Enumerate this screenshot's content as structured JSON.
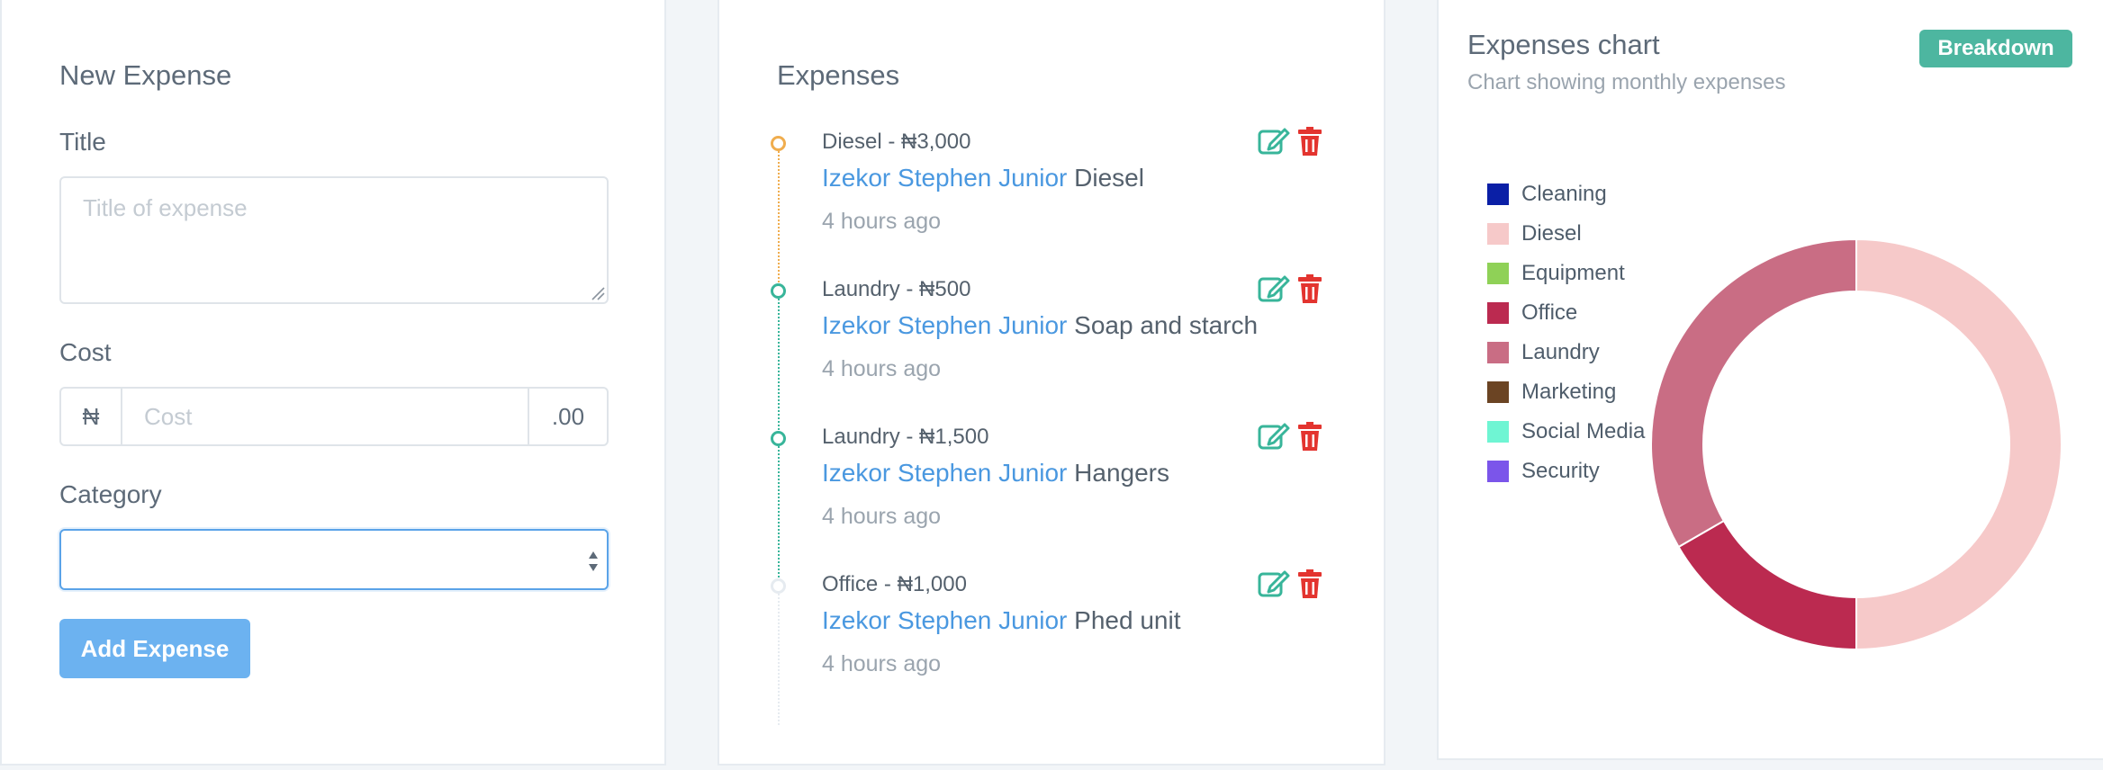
{
  "new_expense": {
    "title": "New Expense",
    "title_label": "Title",
    "title_placeholder": "Title of expense",
    "cost_label": "Cost",
    "currency_prefix": "₦",
    "cost_placeholder": "Cost",
    "cost_suffix": ".00",
    "category_label": "Category",
    "category_value": "",
    "add_button": "Add Expense"
  },
  "expenses": {
    "title": "Expenses",
    "items": [
      {
        "header": "Diesel - ₦3,000",
        "user": "Izekor Stephen Junior",
        "description": "Diesel",
        "time": "4 hours ago",
        "dot_color": "#f0ad4e",
        "line_color": "#f0ad4e"
      },
      {
        "header": "Laundry - ₦500",
        "user": "Izekor Stephen Junior",
        "description": "Soap and starch",
        "time": "4 hours ago",
        "dot_color": "#38b59a",
        "line_color": "#38b59a"
      },
      {
        "header": "Laundry - ₦1,500",
        "user": "Izekor Stephen Junior",
        "description": "Hangers",
        "time": "4 hours ago",
        "dot_color": "#38b59a",
        "line_color": "#38b59a"
      },
      {
        "header": "Office - ₦1,000",
        "user": "Izekor Stephen Junior",
        "description": "Phed unit",
        "time": "4 hours ago",
        "dot_color": "#e6ebf0",
        "line_color": "#e6ebf0"
      }
    ],
    "edit_icon": "edit-icon",
    "delete_icon": "trash-icon",
    "colors": {
      "edit": "#38b59a",
      "delete": "#e3342f"
    }
  },
  "chart_card": {
    "title": "Expenses chart",
    "subtitle": "Chart showing monthly expenses",
    "badge": "Breakdown"
  },
  "chart_data": {
    "type": "pie",
    "donut": true,
    "categories": [
      "Cleaning",
      "Diesel",
      "Equipment",
      "Office",
      "Laundry",
      "Marketing",
      "Social Media",
      "Security"
    ],
    "values": [
      0,
      3000,
      0,
      1000,
      2000,
      0,
      0,
      0
    ],
    "colors": [
      "#0a1fa6",
      "#f6c9c9",
      "#8fd157",
      "#bb2a50",
      "#c96d84",
      "#6b4423",
      "#6ff5d3",
      "#7b55ea"
    ],
    "legend_position": "left"
  }
}
